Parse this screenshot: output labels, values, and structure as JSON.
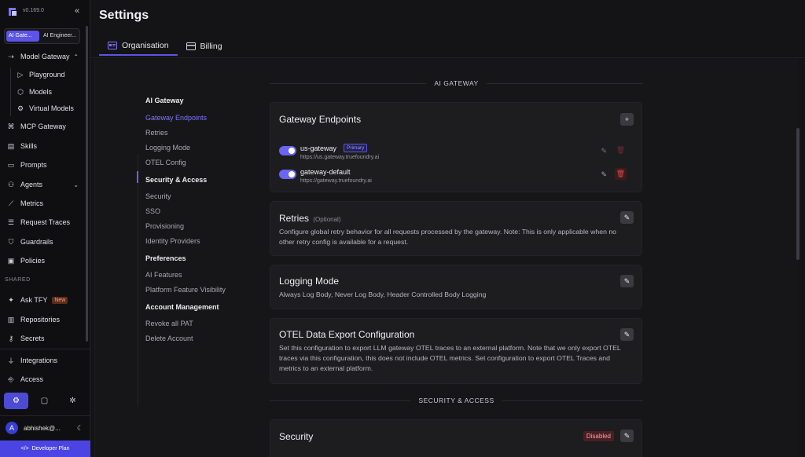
{
  "app": {
    "version": "v0.169.0",
    "collapse_icon": "double-chevron-left-icon"
  },
  "workspace": {
    "active": "AI Gate...",
    "inactive": "AI Engineer..."
  },
  "sidebar": {
    "items": [
      {
        "label": "Model Gateway",
        "icon": "gateway-icon",
        "expanded": true
      },
      {
        "label": "Playground",
        "icon": "play-icon"
      },
      {
        "label": "Models",
        "icon": "cube-icon"
      },
      {
        "label": "Virtual Models",
        "icon": "virtual-model-icon"
      },
      {
        "label": "MCP Gateway",
        "icon": "mcp-icon"
      },
      {
        "label": "Skills",
        "icon": "skills-icon"
      },
      {
        "label": "Prompts",
        "icon": "prompt-icon"
      },
      {
        "label": "Agents",
        "icon": "agent-icon"
      },
      {
        "label": "Metrics",
        "icon": "chart-icon"
      },
      {
        "label": "Request Traces",
        "icon": "traces-icon"
      },
      {
        "label": "Guardrails",
        "icon": "shield-icon"
      },
      {
        "label": "Policies",
        "icon": "policy-icon"
      },
      {
        "label": "Ask TFY",
        "icon": "sparkle-icon",
        "badge": "New"
      },
      {
        "label": "Repositories",
        "icon": "repo-icon"
      },
      {
        "label": "Secrets",
        "icon": "key-icon"
      },
      {
        "label": "Integrations",
        "icon": "plug-icon"
      },
      {
        "label": "Access",
        "icon": "access-icon"
      }
    ],
    "shared_label": "SHARED",
    "user": {
      "initial": "A",
      "name": "abhishek@..."
    },
    "plan_label": "Developer Plan"
  },
  "main": {
    "title": "Settings",
    "tabs": [
      {
        "label": "Organisation",
        "icon": "org-card-icon",
        "active": true
      },
      {
        "label": "Billing",
        "icon": "billing-card-icon",
        "active": false
      }
    ]
  },
  "subnav": {
    "groups": [
      {
        "title": "AI Gateway",
        "items": [
          "Gateway Endpoints",
          "Retries",
          "Logging Mode",
          "OTEL Config"
        ]
      },
      {
        "title": "Security & Access",
        "items": [
          "Security",
          "SSO",
          "Provisioning",
          "Identity Providers"
        ]
      },
      {
        "title": "Preferences",
        "items": [
          "AI Features",
          "Platform Feature Visibility"
        ]
      },
      {
        "title": "Account Management",
        "items": [
          "Revoke all PAT",
          "Delete Account"
        ]
      }
    ],
    "active": "Gateway Endpoints"
  },
  "sections": {
    "ai_gateway": "AI GATEWAY",
    "security_access": "SECURITY & ACCESS"
  },
  "cards": {
    "endpoints": {
      "title": "Gateway Endpoints",
      "rows": [
        {
          "name": "us-gateway",
          "badge": "Primary",
          "url": "https://us.gateway.truefoundry.ai",
          "enabled": true
        },
        {
          "name": "gateway-default",
          "url": "https://gateway.truefoundry.ai",
          "enabled": true
        }
      ]
    },
    "retries": {
      "title": "Retries",
      "optional": "(Optional)",
      "desc": "Configure global retry behavior for all requests processed by the gateway. Note: This is only applicable when no other retry config is available for a request."
    },
    "logging": {
      "title": "Logging Mode",
      "desc": "Always Log Body, Never Log Body, Header Controlled Body Logging"
    },
    "otel": {
      "title": "OTEL Data Export Configuration",
      "desc": "Set this configuration to export LLM gateway OTEL traces to an external platform. Note that we only export OTEL traces via this configuration, this does not include OTEL metrics. Set configuration to export OTEL Traces and metrics to an external platform."
    },
    "security": {
      "title": "Security",
      "status": "Disabled"
    }
  },
  "colors": {
    "accent": "#5b54e8",
    "danger": "#e04444"
  }
}
